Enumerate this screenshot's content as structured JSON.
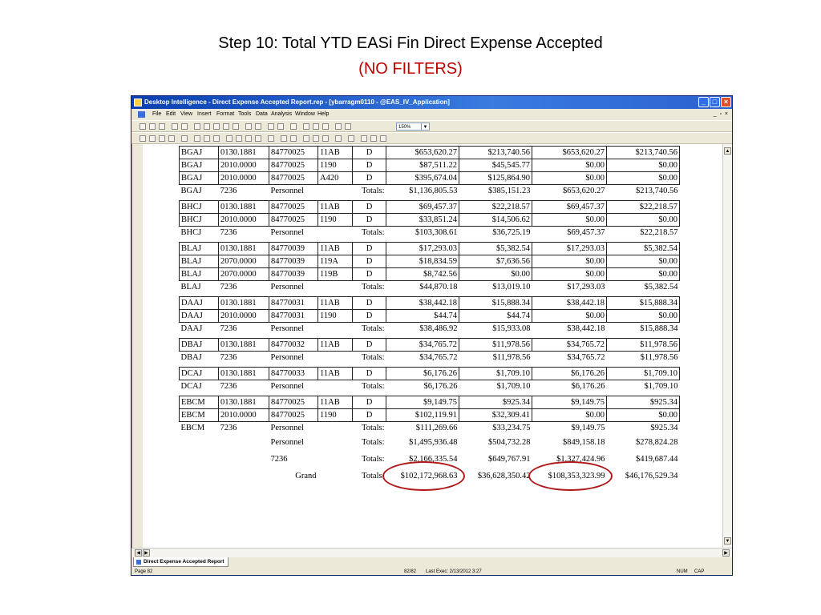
{
  "slide": {
    "title": "Step 10:  Total YTD EASi Fin Direct Expense Accepted",
    "subtitle": "(NO FILTERS)"
  },
  "window": {
    "title": "Desktop Intelligence - Direct Expense Accepted Report.rep - [ybarragm0110 - @EAS_IV_Application]",
    "buttons": {
      "minimize": "_",
      "maximize": "□",
      "close": "×"
    }
  },
  "menubar": {
    "items": [
      "File",
      "Edit",
      "View",
      "Insert",
      "Format",
      "Tools",
      "Data",
      "Analysis",
      "Window",
      "Help"
    ],
    "mdi_controls": "_ ▫ ×"
  },
  "toolbar": {
    "zoom": "150%"
  },
  "report": {
    "groups": [
      {
        "rows": [
          [
            "BGAJ",
            "0130.1881",
            "84770025",
            "11AB",
            "D",
            "$653,620.27",
            "$213,740.56",
            "$653,620.27",
            "$213,740.56"
          ],
          [
            "BGAJ",
            "2010.0000",
            "84770025",
            "1190",
            "D",
            "$87,511.22",
            "$45,545.77",
            "$0.00",
            "$0.00"
          ],
          [
            "BGAJ",
            "2010.0000",
            "84770025",
            "A420",
            "D",
            "$395,674.04",
            "$125,864.90",
            "$0.00",
            "$0.00"
          ]
        ],
        "total": [
          "BGAJ",
          "7236",
          "Personnel",
          "Totals:",
          "$1,136,805.53",
          "$385,151.23",
          "$653,620.27",
          "$213,740.56"
        ]
      },
      {
        "rows": [
          [
            "BHCJ",
            "0130.1881",
            "84770025",
            "11AB",
            "D",
            "$69,457.37",
            "$22,218.57",
            "$69,457.37",
            "$22,218.57"
          ],
          [
            "BHCJ",
            "2010.0000",
            "84770025",
            "1190",
            "D",
            "$33,851.24",
            "$14,506.62",
            "$0.00",
            "$0.00"
          ]
        ],
        "total": [
          "BHCJ",
          "7236",
          "Personnel",
          "Totals:",
          "$103,308.61",
          "$36,725.19",
          "$69,457.37",
          "$22,218.57"
        ]
      },
      {
        "rows": [
          [
            "BLAJ",
            "0130.1881",
            "84770039",
            "11AB",
            "D",
            "$17,293.03",
            "$5,382.54",
            "$17,293.03",
            "$5,382.54"
          ],
          [
            "BLAJ",
            "2070.0000",
            "84770039",
            "119A",
            "D",
            "$18,834.59",
            "$7,636.56",
            "$0.00",
            "$0.00"
          ],
          [
            "BLAJ",
            "2070.0000",
            "84770039",
            "119B",
            "D",
            "$8,742.56",
            "$0.00",
            "$0.00",
            "$0.00"
          ]
        ],
        "total": [
          "BLAJ",
          "7236",
          "Personnel",
          "Totals:",
          "$44,870.18",
          "$13,019.10",
          "$17,293.03",
          "$5,382.54"
        ]
      },
      {
        "rows": [
          [
            "DAAJ",
            "0130.1881",
            "84770031",
            "11AB",
            "D",
            "$38,442.18",
            "$15,888.34",
            "$38,442.18",
            "$15,888.34"
          ],
          [
            "DAAJ",
            "2010.0000",
            "84770031",
            "1190",
            "D",
            "$44.74",
            "$44.74",
            "$0.00",
            "$0.00"
          ]
        ],
        "total": [
          "DAAJ",
          "7236",
          "Personnel",
          "Totals:",
          "$38,486.92",
          "$15,933.08",
          "$38,442.18",
          "$15,888.34"
        ]
      },
      {
        "rows": [
          [
            "DBAJ",
            "0130.1881",
            "84770032",
            "11AB",
            "D",
            "$34,765.72",
            "$11,978.56",
            "$34,765.72",
            "$11,978.56"
          ]
        ],
        "total": [
          "DBAJ",
          "7236",
          "Personnel",
          "Totals:",
          "$34,765.72",
          "$11,978.56",
          "$34,765.72",
          "$11,978.56"
        ]
      },
      {
        "rows": [
          [
            "DCAJ",
            "0130.1881",
            "84770033",
            "11AB",
            "D",
            "$6,176.26",
            "$1,709.10",
            "$6,176.26",
            "$1,709.10"
          ]
        ],
        "total": [
          "DCAJ",
          "7236",
          "Personnel",
          "Totals:",
          "$6,176.26",
          "$1,709.10",
          "$6,176.26",
          "$1,709.10"
        ]
      },
      {
        "rows": [
          [
            "EBCM",
            "0130.1881",
            "84770025",
            "11AB",
            "D",
            "$9,149.75",
            "$925.34",
            "$9,149.75",
            "$925.34"
          ],
          [
            "EBCM",
            "2010.0000",
            "84770025",
            "1190",
            "D",
            "$102,119.91",
            "$32,309.41",
            "$0.00",
            "$0.00"
          ]
        ],
        "total": [
          "EBCM",
          "7236",
          "Personnel",
          "Totals:",
          "$111,269.66",
          "$33,234.75",
          "$9,149.75",
          "$925.34"
        ]
      }
    ],
    "summary": [
      {
        "label": "Personnel",
        "pre": "",
        "totals": "Totals:",
        "values": [
          "$1,495,936.48",
          "$504,732.28",
          "$849,158.18",
          "$278,824.28"
        ]
      },
      {
        "label": "7236",
        "pre": "",
        "totals": "Totals:",
        "values": [
          "$2,166,335.54",
          "$649,767.91",
          "$1,327,424.96",
          "$419,687.44"
        ]
      },
      {
        "label": "",
        "pre": "Grand",
        "totals": "Totals:",
        "values": [
          "$102,172,968.63",
          "$36,628,350.42",
          "$108,353,323.99",
          "$46,176,529.34"
        ]
      }
    ]
  },
  "tab": {
    "label": "Direct Expense Accepted Report"
  },
  "status": {
    "page": "Page 82",
    "pages": "82/82",
    "last_exec": "Last Exec: 2/13/2012 3:27",
    "num": "NUM",
    "cap": "CAP"
  },
  "annotation_color": "#b01818"
}
